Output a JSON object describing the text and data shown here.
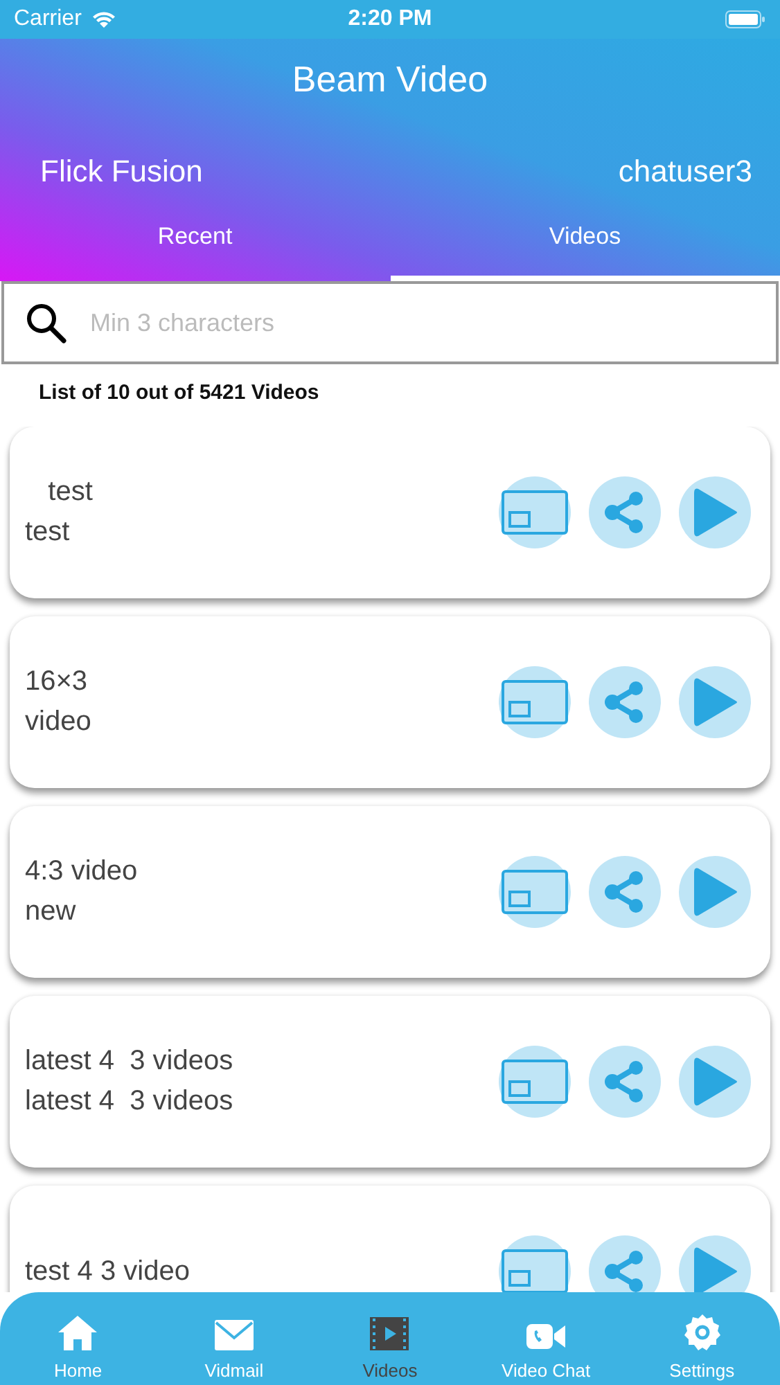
{
  "status_bar": {
    "carrier": "Carrier",
    "time": "2:20 PM"
  },
  "header": {
    "title": "Beam Video",
    "left": "Flick Fusion",
    "right": "chatuser3"
  },
  "tabs": [
    {
      "label": "Recent",
      "selected": false
    },
    {
      "label": "Videos",
      "selected": true
    }
  ],
  "search": {
    "placeholder": "Min 3 characters"
  },
  "list_summary": "List of 10 out of 5421 Videos",
  "videos": [
    {
      "lines": [
        "   test",
        "test"
      ]
    },
    {
      "lines": [
        "16×3",
        "video"
      ]
    },
    {
      "lines": [
        "4:3 video",
        "new"
      ]
    },
    {
      "lines": [
        "latest 4  3 videos",
        "latest 4  3 videos"
      ]
    },
    {
      "lines": [
        "test 4 3 video"
      ]
    }
  ],
  "bottom_tabs": [
    {
      "label": "Home",
      "kind": "home",
      "selected": false
    },
    {
      "label": "Vidmail",
      "kind": "mail",
      "selected": false
    },
    {
      "label": "Videos",
      "kind": "film",
      "selected": true
    },
    {
      "label": "Video Chat",
      "kind": "videochat",
      "selected": false
    },
    {
      "label": "Settings",
      "kind": "settings",
      "selected": false
    }
  ]
}
